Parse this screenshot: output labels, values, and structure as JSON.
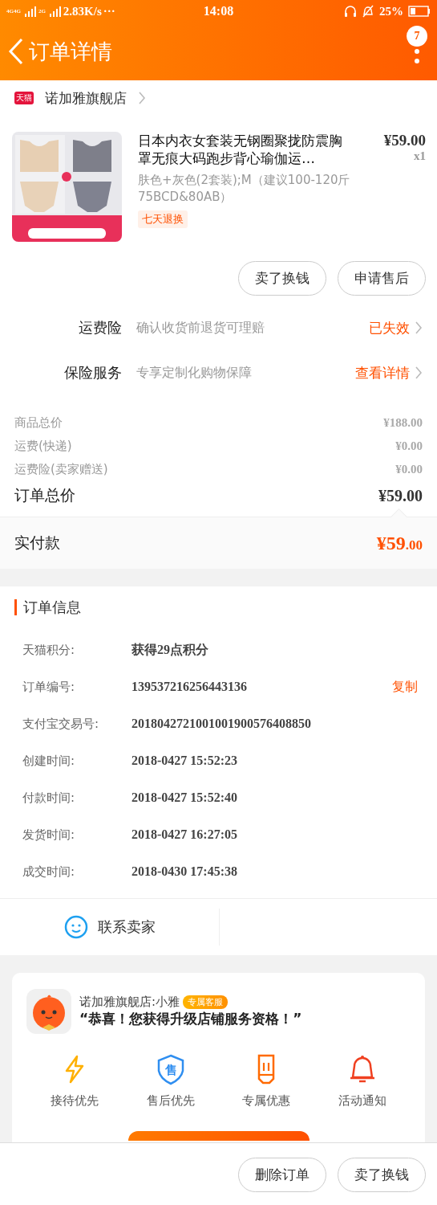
{
  "status_bar": {
    "network": [
      "4G4G",
      "2G"
    ],
    "speed": "2.83K/s",
    "more": "···",
    "time": "14:08",
    "battery": "25%"
  },
  "header": {
    "title": "订单详情",
    "badge": "7"
  },
  "store": {
    "logo": "天猫",
    "name": "诺加雅旗舰店"
  },
  "product": {
    "title": "日本内衣女套装无钢圈聚拢防震胸罩无痕大码跑步背心瑜伽运…",
    "price": "¥59.00",
    "quantity": "x1",
    "sku": "肤色+灰色(2套装);M（建议100-120斤 75BCD&80AB）",
    "tag": "七天退换"
  },
  "item_buttons": [
    "卖了换钱",
    "申请售后"
  ],
  "services": [
    {
      "label": "运费险",
      "desc": "确认收货前退货可理赔",
      "action": "已失效"
    },
    {
      "label": "保险服务",
      "desc": "专享定制化购物保障",
      "action": "查看详情"
    }
  ],
  "price_rows": [
    {
      "kind": "minor",
      "label": "商品总价",
      "value": "¥188.00"
    },
    {
      "kind": "minor",
      "label": "运费(快递)",
      "value": "¥0.00"
    },
    {
      "kind": "minor",
      "label": "运费险(卖家赠送)",
      "value": "¥0.00"
    },
    {
      "kind": "total",
      "label": "订单总价",
      "value": "¥59.00"
    }
  ],
  "paid": {
    "label": "实付款",
    "currency": "¥",
    "amount": "59",
    "cents": ".00"
  },
  "order_info": {
    "title": "订单信息",
    "rows": [
      {
        "label": "天猫积分:",
        "value": "获得29点积分"
      },
      {
        "label": "订单编号:",
        "value": "139537216256443136",
        "action": "复制"
      },
      {
        "label": "支付宝交易号:",
        "value": "2018042721001001900576408850"
      },
      {
        "label": "创建时间:",
        "value": "2018-0427 15:52:23"
      },
      {
        "label": "付款时间:",
        "value": "2018-0427 15:52:40"
      },
      {
        "label": "发货时间:",
        "value": "2018-0427 16:27:05"
      },
      {
        "label": "成交时间:",
        "value": "2018-0430 17:45:38"
      }
    ]
  },
  "contact": {
    "label": "联系卖家"
  },
  "promo": {
    "shop": "诺加雅旗舰店:小雅",
    "badge": "专属客服",
    "message": "“恭喜！您获得升级店铺服务资格！”",
    "perks": [
      {
        "kind": "bolt",
        "label": "接待优先"
      },
      {
        "kind": "shield",
        "glyph": "售",
        "label": "售后优先"
      },
      {
        "kind": "ticket",
        "label": "专属优惠"
      },
      {
        "kind": "bell",
        "label": "活动通知"
      }
    ]
  },
  "bottom_buttons": [
    "删除订单",
    "卖了换钱"
  ]
}
